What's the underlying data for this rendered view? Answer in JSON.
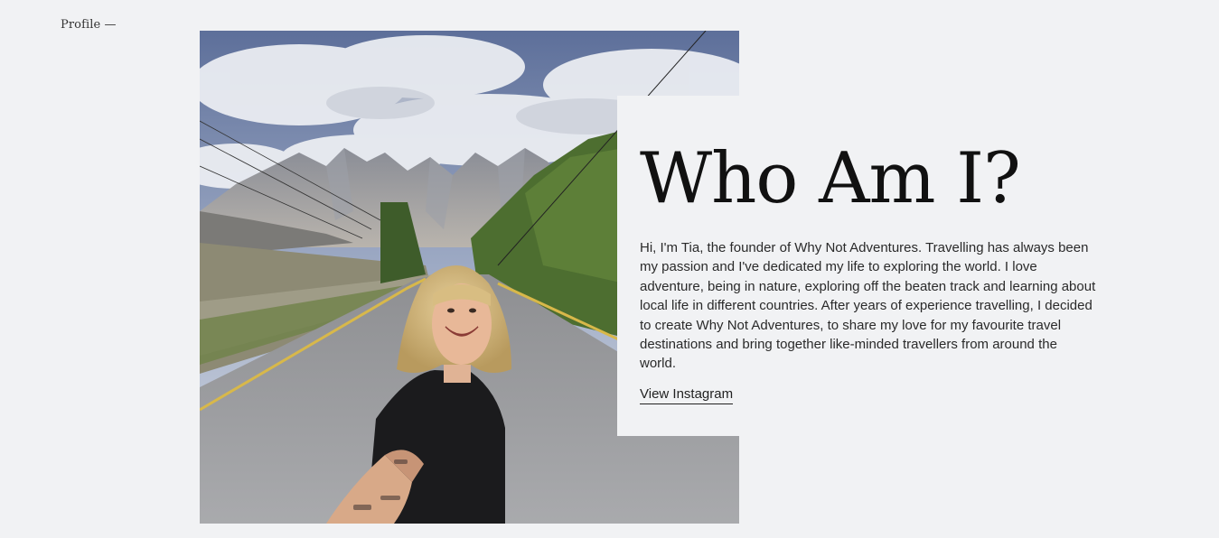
{
  "section": {
    "label": "Profile —"
  },
  "hero": {
    "heading": "Who Am I?",
    "bio": "Hi, I'm Tia, the founder of Why Not Adventures. Travelling has always been my passion and I've dedicated my life to exploring the world. I love adventure, being in nature, exploring off the beaten track and learning about local life in different countries. After years of experience travelling, I decided to create Why Not Adventures, to share my love for my favourite travel destinations and bring together like-minded travellers from around the world.",
    "link_label": "View Instagram",
    "photo_alt": "Selfie of a smiling woman on a mountain road"
  },
  "colors": {
    "background": "#f1f2f4",
    "text": "#111111"
  }
}
